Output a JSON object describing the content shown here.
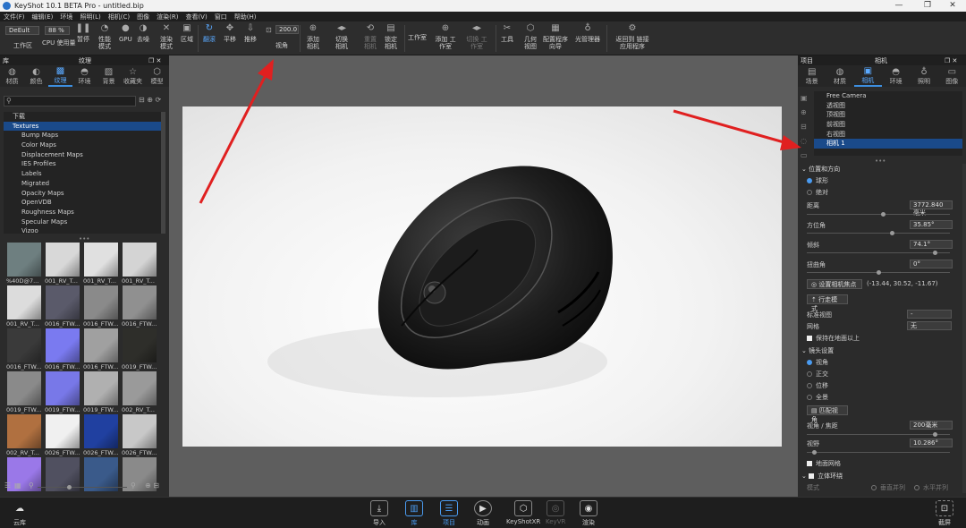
{
  "window": {
    "title": "KeyShot 10.1 BETA Pro - untitled.bip",
    "minimize": "—",
    "maximize": "❐",
    "close": "✕"
  },
  "menu": [
    "文件(F)",
    "编辑(E)",
    "环境",
    "照明(L)",
    "相机(C)",
    "图像",
    "渲染(R)",
    "查看(V)",
    "窗口",
    "帮助(H)"
  ],
  "toolbar": {
    "workspace_value": "DeEult",
    "zoom_value": "88 %",
    "workspace_label": "工作区",
    "cpu": "CPU 使用量",
    "pause": "暂停",
    "perf_mode": "性能 模式",
    "gpu": "GPU",
    "denoise": "去噪",
    "render_mode": "渲染 模式",
    "region": "区域",
    "rotate": "翻滚",
    "pan": "平移",
    "dolly": "推移",
    "fov_value": "200.0",
    "fov_label": "视角",
    "add_camera": "添加 相机",
    "switch_camera": "切换 相机",
    "reset_camera": "重置 相机",
    "lock_camera": "锁定 相机",
    "studio": "工作室",
    "add_studio": "添加 工作室",
    "switch_studio": "切换 工作室",
    "tools": "工具",
    "geometry_view": "几何 视图",
    "config_wizard": "配置程序 向导",
    "light_manager": "光管理器",
    "link_apps": "返回到 链接应用程序"
  },
  "library": {
    "panel_title": "库",
    "tab_title": "纹理",
    "tabs": [
      {
        "label": "材质",
        "icon": "material-icon"
      },
      {
        "label": "颜色",
        "icon": "color-icon"
      },
      {
        "label": "纹理",
        "icon": "texture-icon"
      },
      {
        "label": "环境",
        "icon": "environment-icon"
      },
      {
        "label": "背景",
        "icon": "background-icon"
      },
      {
        "label": "收藏夹",
        "icon": "favorites-icon"
      },
      {
        "label": "模型",
        "icon": "model-icon"
      }
    ],
    "tree": [
      "下载",
      "Textures",
      "Bump Maps",
      "Color Maps",
      "Displacement Maps",
      "IES Profiles",
      "Labels",
      "Migrated",
      "Opacity Maps",
      "OpenVDB",
      "Roughness Maps",
      "Specular Maps",
      "Vizoo"
    ],
    "thumbs": [
      {
        "label": "%40D@7...",
        "color": "#6e7f80"
      },
      {
        "label": "001_RV_T...",
        "color": "#d8d8d8"
      },
      {
        "label": "001_RV_T...",
        "color": "#e0e0e0"
      },
      {
        "label": "001_RV_T...",
        "color": "#d4d4d4"
      },
      {
        "label": "001_RV_T...",
        "color": "#dcdcdc"
      },
      {
        "label": "0016_FTW...",
        "color": "#5a5a6a"
      },
      {
        "label": "0016_FTW...",
        "color": "#8a8a8a"
      },
      {
        "label": "0016_FTW...",
        "color": "#909090"
      },
      {
        "label": "0016_FTW...",
        "color": "#3a3a3a"
      },
      {
        "label": "0016_FTW...",
        "color": "#7a7af0"
      },
      {
        "label": "0016_FTW...",
        "color": "#a0a0a0"
      },
      {
        "label": "0019_FTW...",
        "color": "#2e2e2a"
      },
      {
        "label": "0019_FTW...",
        "color": "#8a8a8a"
      },
      {
        "label": "0019_FTW...",
        "color": "#7878e8"
      },
      {
        "label": "0019_FTW...",
        "color": "#b0b0b0"
      },
      {
        "label": "002_RV_T...",
        "color": "#9a9a9a"
      },
      {
        "label": "002_RV_T...",
        "color": "#b07040"
      },
      {
        "label": "0026_FTW...",
        "color": "#f0f0f0"
      },
      {
        "label": "0026_FTW...",
        "color": "#2040a0"
      },
      {
        "label": "0026_FTW...",
        "color": "#c8c8c8"
      },
      {
        "label": "",
        "color": "#9a78e8"
      },
      {
        "label": "",
        "color": "#505060"
      },
      {
        "label": "",
        "color": "#3a5a8a"
      },
      {
        "label": "",
        "color": "#8a8a8a"
      }
    ]
  },
  "project": {
    "panel_title": "项目",
    "tab_title": "相机",
    "tabs": [
      {
        "label": "场景",
        "icon": "scene-icon"
      },
      {
        "label": "材质",
        "icon": "material-icon"
      },
      {
        "label": "相机",
        "icon": "camera-icon"
      },
      {
        "label": "环境",
        "icon": "environment-icon"
      },
      {
        "label": "照明",
        "icon": "lighting-icon"
      },
      {
        "label": "图像",
        "icon": "image-icon"
      }
    ],
    "cameras": [
      "Free Camera",
      "透视图",
      "顶视图",
      "前视图",
      "右视图",
      "相机 1"
    ],
    "section_position": "位置和方向",
    "orbit": "球形",
    "absolute": "绝对",
    "distance_label": "距离",
    "distance": "3772.840毫米",
    "azimuth_label": "方位角",
    "azimuth": "35.85°",
    "inclination_label": "倾斜",
    "inclination": "74.1°",
    "twist_label": "扭曲角",
    "twist": "0°",
    "set_lookat": "设置相机焦点",
    "lookat_coords": "(-13.44, 30.52, -11.67)",
    "walk_mode": "行走模式",
    "std_view_label": "标准视图",
    "std_view": "-",
    "grid_label": "网格",
    "grid": "无",
    "keep_above": "保持在地面以上",
    "section_lens": "镜头设置",
    "perspective": "视角",
    "ortho": "正交",
    "shift": "位移",
    "panorama": "全景",
    "match_persp": "匹配视角",
    "focal_label": "视角 / 焦距",
    "focal": "200毫米",
    "fov_label": "视野",
    "fov": "10.286°",
    "ground_grid": "地面网格",
    "section_stereo": "立体环绕",
    "mode_label": "模式",
    "vertical": "垂直并列",
    "horizontal": "水平并列"
  },
  "bottom": {
    "cloud": "云库",
    "import": "导入",
    "library": "库",
    "project": "项目",
    "animation": "动画",
    "ks_xr": "KeyShotXR",
    "keyvr": "KeyVR",
    "render": "渲染",
    "screenshot": "截屏"
  },
  "colors": {
    "accent": "#3d8fe0",
    "selection": "#1a4a8a",
    "arrow": "#e02020"
  }
}
